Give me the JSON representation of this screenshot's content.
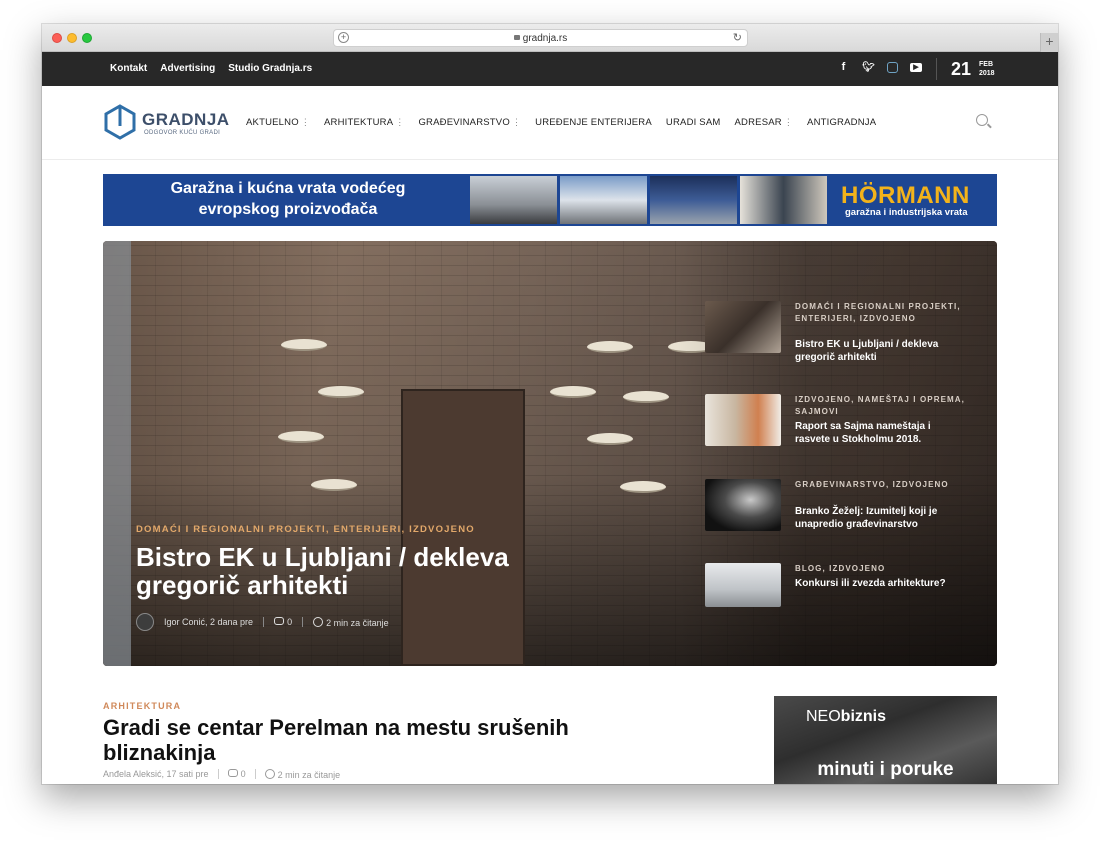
{
  "browser": {
    "url": "gradnja.rs"
  },
  "topbar": {
    "links": [
      "Kontakt",
      "Advertising",
      "Studio Gradnja.rs"
    ],
    "date_day": "21",
    "date_month": "FEB",
    "date_year": "2018"
  },
  "logo": {
    "name": "GRADNJA",
    "tagline": "ODGOVOR KUĆU GRADI"
  },
  "nav": {
    "items": [
      {
        "label": "AKTUELNO",
        "has_submenu": true
      },
      {
        "label": "ARHITEKTURA",
        "has_submenu": true
      },
      {
        "label": "GRAĐEVINARSTVO",
        "has_submenu": true
      },
      {
        "label": "UREĐENJE ENTERIJERA",
        "has_submenu": false
      },
      {
        "label": "URADI SAM",
        "has_submenu": false
      },
      {
        "label": "ADRESAR",
        "has_submenu": true
      },
      {
        "label": "ANTIGRADNJA",
        "has_submenu": false
      }
    ],
    "submenu_glyph": "⋮"
  },
  "banner_ad": {
    "line1": "Garažna i kućna vrata vodećeg",
    "line2": "evropskog proizvođača",
    "brand": "HÖRMANN",
    "brand_sub": "garažna i industrijska vrata"
  },
  "hero": {
    "category": "DOMAĆI I REGIONALNI PROJEKTI, ENTERIJERI, IZDVOJENO",
    "title": "Bistro EK u Ljubljani / dekleva gregorič arhitekti",
    "author_time": "Igor Conić, 2 dana pre",
    "comments": "0",
    "read_time": "2 min za čitanje",
    "side_posts": [
      {
        "category": "DOMAĆI I REGIONALNI PROJEKTI, ENTERIJERI, IZDVOJENO",
        "title": "Bistro EK u Ljubljani / dekleva gregorič arhitekti"
      },
      {
        "category": "IZDVOJENO, NAMEŠTAJ I OPREMA, SAJMOVI",
        "title": "Raport sa Sajma nameštaja i rasvete u Stokholmu 2018."
      },
      {
        "category": "GRAĐEVINARSTVO, IZDVOJENO",
        "title": "Branko Žeželj: Izumitelj koji je unapredio građevinarstvo"
      },
      {
        "category": "BLOG, IZDVOJENO",
        "title": "Konkursi ili zvezda arhitekture?"
      }
    ]
  },
  "article": {
    "category": "ARHITEKTURA",
    "title": "Gradi se centar Perelman na mestu srušenih bliznakinja",
    "author_time": "Anđela Aleksić, 17 sati pre",
    "comments": "0",
    "read_time": "2 min za čitanje"
  },
  "side_ad": {
    "logo_light": "NEO",
    "logo_bold": "biznis",
    "text": "minuti i poruke"
  },
  "colors": {
    "topbar": "#282828",
    "accent": "#d0895a",
    "ad_blue": "#1d4693",
    "ad_yellow": "#f3b31b"
  }
}
